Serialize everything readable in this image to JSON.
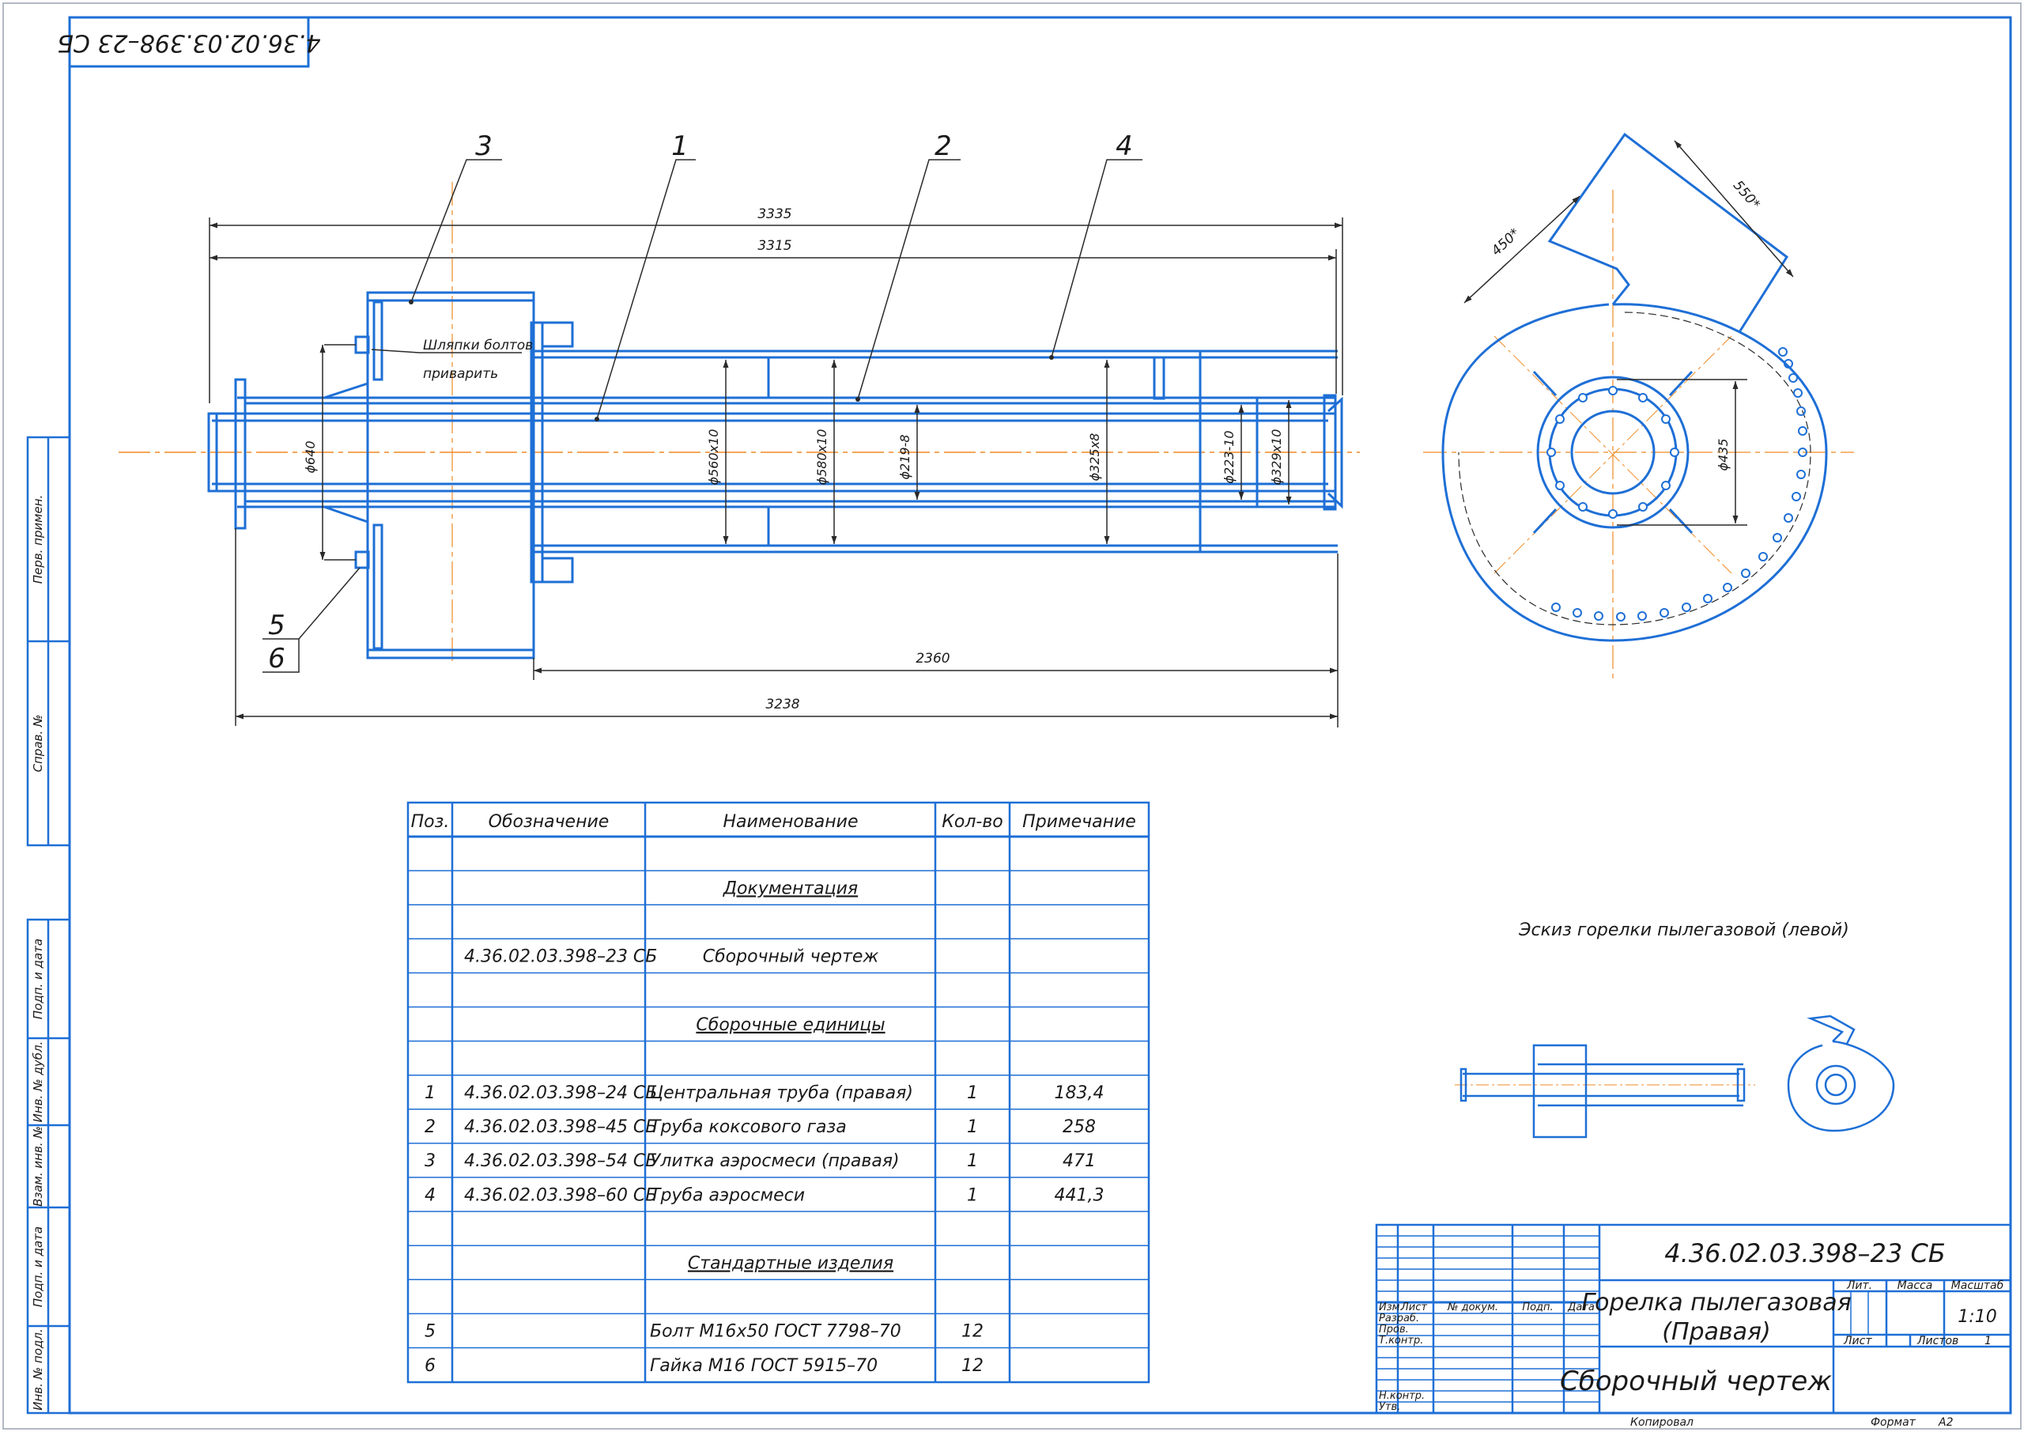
{
  "doc_code_rotated": "4.36.02.03.398–23 СБ",
  "colors": {
    "frame": "#1e6fd6",
    "line": "#2a2a2a",
    "axis": "#f08a24",
    "text": "#1a1a1a"
  },
  "callouts": {
    "c1": "1",
    "c2": "2",
    "c3": "3",
    "c4": "4",
    "c5": "5",
    "c6": "6"
  },
  "notes": {
    "weld_line1": "Шляпки болтов",
    "weld_line2": "приварить"
  },
  "dims": {
    "d3335": "3335",
    "d3315": "3315",
    "d2360": "2360",
    "d3238": "3238",
    "dia640": "ϕ640",
    "dia560": "ϕ560х10",
    "dia580": "ϕ580х10",
    "dia219": "ϕ219-8",
    "dia325": "ϕ325х8",
    "dia223": "ϕ223-10",
    "dia329": "ϕ329х10",
    "d450": "450*",
    "d550": "550*",
    "dia435": "ϕ435"
  },
  "sketch_caption": "Эскиз горелки пылегазовой (левой)",
  "spec_table": {
    "headers": [
      "Поз.",
      "Обозначение",
      "Наименование",
      "Кол-во",
      "Примечание"
    ],
    "rows": [
      {
        "pos": "",
        "code": "",
        "name": "",
        "qty": "",
        "note": ""
      },
      {
        "pos": "",
        "code": "",
        "section": "Документация",
        "qty": "",
        "note": ""
      },
      {
        "pos": "",
        "code": "",
        "name": "",
        "qty": "",
        "note": ""
      },
      {
        "pos": "",
        "code": "4.36.02.03.398–23 СБ",
        "section_plain": "Сборочный чертеж",
        "qty": "",
        "note": ""
      },
      {
        "pos": "",
        "code": "",
        "name": "",
        "qty": "",
        "note": ""
      },
      {
        "pos": "",
        "code": "",
        "section": "Сборочные единицы",
        "qty": "",
        "note": ""
      },
      {
        "pos": "",
        "code": "",
        "name": "",
        "qty": "",
        "note": ""
      },
      {
        "pos": "1",
        "code": "4.36.02.03.398–24 СБ",
        "name": "Центральная труба (правая)",
        "qty": "1",
        "note": "183,4"
      },
      {
        "pos": "2",
        "code": "4.36.02.03.398–45 СБ",
        "name": "Труба коксового газа",
        "qty": "1",
        "note": "258"
      },
      {
        "pos": "3",
        "code": "4.36.02.03.398–54 СБ",
        "name": "Улитка аэросмеси (правая)",
        "qty": "1",
        "note": "471"
      },
      {
        "pos": "4",
        "code": "4.36.02.03.398–60 СБ",
        "name": "Труба аэросмеси",
        "qty": "1",
        "note": "441,3"
      },
      {
        "pos": "",
        "code": "",
        "name": "",
        "qty": "",
        "note": ""
      },
      {
        "pos": "",
        "code": "",
        "section": "Стандартные изделия",
        "qty": "",
        "note": ""
      },
      {
        "pos": "",
        "code": "",
        "name": "",
        "qty": "",
        "note": ""
      },
      {
        "pos": "5",
        "code": "",
        "name": "Болт М16х50 ГОСТ 7798–70",
        "qty": "12",
        "note": ""
      },
      {
        "pos": "6",
        "code": "",
        "name": "Гайка М16 ГОСТ 5915–70",
        "qty": "12",
        "note": ""
      }
    ]
  },
  "side_stamps": [
    "Перв. примен.",
    "Справ. №",
    "Подп. и дата",
    "Инв. № дубл.",
    "Взам. инв. №",
    "Подп. и дата",
    "Инв. № подл."
  ],
  "title_block": {
    "code": "4.36.02.03.398–23 СБ",
    "name_line1": "Горелка пылегазовая",
    "name_line2": "(Правая)",
    "doc_type": "Сборочный чертеж",
    "hdr_izm": "Изм.",
    "hdr_list": "Лист",
    "hdr_docnum": "№ докум.",
    "hdr_podp": "Подп.",
    "hdr_data": "Дата",
    "role_razrab": "Разраб.",
    "role_prov": "Пров.",
    "role_tkontr": "Т.контр.",
    "role_nkontr": "Н.контр.",
    "role_utv": "Утв.",
    "lit_label": "Лит.",
    "mass_label": "Масса",
    "scale_label": "Масштаб",
    "scale_value": "1:10",
    "sheet_label": "Лист",
    "sheets_label": "Листов",
    "sheets_value": "1",
    "copied_label": "Копировал",
    "format_label": "Формат",
    "format_value": "А2"
  }
}
